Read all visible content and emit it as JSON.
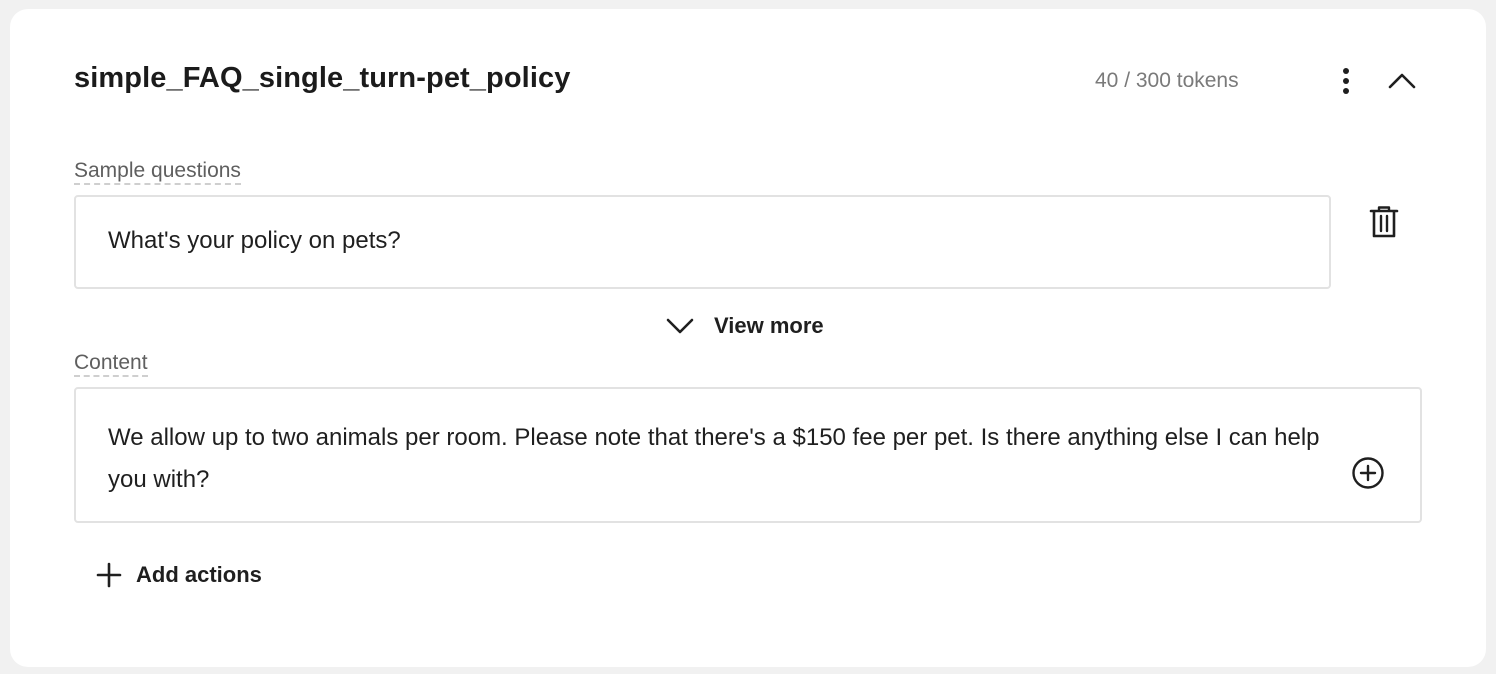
{
  "card": {
    "title": "simple_FAQ_single_turn-pet_policy",
    "token_count": "40 / 300 tokens"
  },
  "icons": {
    "menu": "more-vertical-icon",
    "collapse": "chevron-up-icon",
    "delete": "trash-icon",
    "expand": "chevron-down-icon",
    "insert": "plus-circle-icon",
    "add": "plus-icon"
  },
  "sample_questions": {
    "label": "Sample questions",
    "items": [
      "What's your policy on pets?"
    ],
    "view_more_label": "View more"
  },
  "content": {
    "label": "Content",
    "text": "We allow up to two animals per room. Please note that there's a $150 fee per pet. Is there anything else I can help you with?"
  },
  "actions": {
    "add_label": "Add actions"
  },
  "colors": {
    "page_background": "#f1f1f1",
    "card_background": "#ffffff",
    "border": "#e2e2e2",
    "muted_text": "#7a7a7a"
  }
}
